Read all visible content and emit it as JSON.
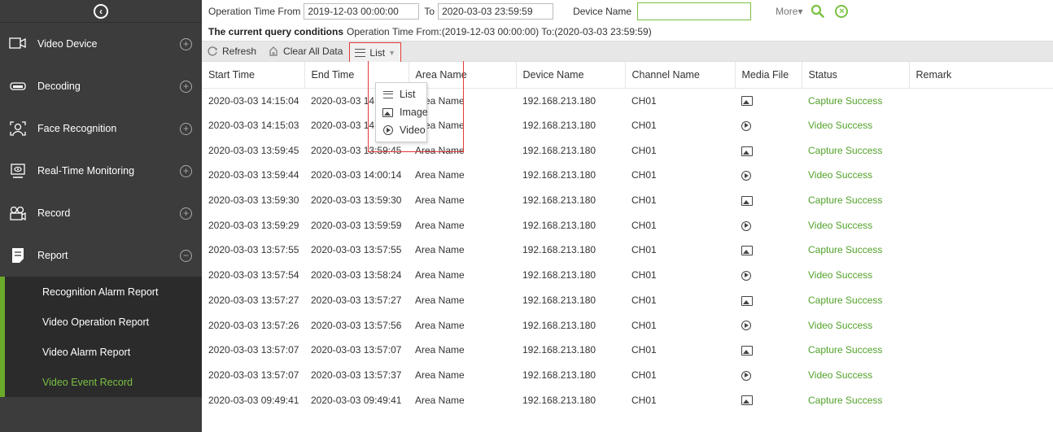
{
  "sidebar": {
    "items": [
      {
        "label": "Video Device",
        "icon": "video-device-icon",
        "toggle": "+"
      },
      {
        "label": "Decoding",
        "icon": "decoding-icon",
        "toggle": "+"
      },
      {
        "label": "Face Recognition",
        "icon": "face-recognition-icon",
        "toggle": "+"
      },
      {
        "label": "Real-Time Monitoring",
        "icon": "monitor-icon",
        "toggle": "+"
      },
      {
        "label": "Record",
        "icon": "record-icon",
        "toggle": "+"
      },
      {
        "label": "Report",
        "icon": "report-icon",
        "toggle": "−"
      }
    ],
    "submenu": [
      "Recognition Alarm Report",
      "Video Operation Report",
      "Video Alarm Report",
      "Video Event Record"
    ],
    "active_submenu": "Video Event Record",
    "accent": "#7ac142"
  },
  "filter": {
    "from_label": "Operation Time From",
    "from_value": "2019-12-03 00:00:00",
    "to_label": "To",
    "to_value": "2020-03-03 23:59:59",
    "device_label": "Device Name",
    "device_value": "",
    "more_label": "More",
    "more_arrow": "▾"
  },
  "conditions": {
    "title": "The current query conditions",
    "text": "Operation Time From:(2019-12-03 00:00:00)  To:(2020-03-03 23:59:59)"
  },
  "toolbar": {
    "refresh": "Refresh",
    "clear": "Clear All Data",
    "view": "List"
  },
  "dropdown": {
    "items": [
      {
        "label": "List",
        "icon": "list-icon"
      },
      {
        "label": "Image",
        "icon": "image-icon"
      },
      {
        "label": "Video",
        "icon": "video-play-icon"
      }
    ]
  },
  "table": {
    "headers": [
      "Start Time",
      "End Time",
      "Area Name",
      "Device Name",
      "Channel Name",
      "Media File",
      "Status",
      "Remark"
    ],
    "rows": [
      {
        "start": "2020-03-03 14:15:04",
        "end": "2020-03-03 14:15:04",
        "area": "Area Name",
        "device": "192.168.213.180",
        "channel": "CH01",
        "media": "image",
        "status": "Capture Success",
        "remark": ""
      },
      {
        "start": "2020-03-03 14:15:03",
        "end": "2020-03-03 14:15:33",
        "area": "Area Name",
        "device": "192.168.213.180",
        "channel": "CH01",
        "media": "video",
        "status": "Video Success",
        "remark": ""
      },
      {
        "start": "2020-03-03 13:59:45",
        "end": "2020-03-03 13:59:45",
        "area": "Area Name",
        "device": "192.168.213.180",
        "channel": "CH01",
        "media": "image",
        "status": "Capture Success",
        "remark": ""
      },
      {
        "start": "2020-03-03 13:59:44",
        "end": "2020-03-03 14:00:14",
        "area": "Area Name",
        "device": "192.168.213.180",
        "channel": "CH01",
        "media": "video",
        "status": "Video Success",
        "remark": ""
      },
      {
        "start": "2020-03-03 13:59:30",
        "end": "2020-03-03 13:59:30",
        "area": "Area Name",
        "device": "192.168.213.180",
        "channel": "CH01",
        "media": "image",
        "status": "Capture Success",
        "remark": ""
      },
      {
        "start": "2020-03-03 13:59:29",
        "end": "2020-03-03 13:59:59",
        "area": "Area Name",
        "device": "192.168.213.180",
        "channel": "CH01",
        "media": "video",
        "status": "Video Success",
        "remark": ""
      },
      {
        "start": "2020-03-03 13:57:55",
        "end": "2020-03-03 13:57:55",
        "area": "Area Name",
        "device": "192.168.213.180",
        "channel": "CH01",
        "media": "image",
        "status": "Capture Success",
        "remark": ""
      },
      {
        "start": "2020-03-03 13:57:54",
        "end": "2020-03-03 13:58:24",
        "area": "Area Name",
        "device": "192.168.213.180",
        "channel": "CH01",
        "media": "video",
        "status": "Video Success",
        "remark": ""
      },
      {
        "start": "2020-03-03 13:57:27",
        "end": "2020-03-03 13:57:27",
        "area": "Area Name",
        "device": "192.168.213.180",
        "channel": "CH01",
        "media": "image",
        "status": "Capture Success",
        "remark": ""
      },
      {
        "start": "2020-03-03 13:57:26",
        "end": "2020-03-03 13:57:56",
        "area": "Area Name",
        "device": "192.168.213.180",
        "channel": "CH01",
        "media": "video",
        "status": "Video Success",
        "remark": ""
      },
      {
        "start": "2020-03-03 13:57:07",
        "end": "2020-03-03 13:57:07",
        "area": "Area Name",
        "device": "192.168.213.180",
        "channel": "CH01",
        "media": "image",
        "status": "Capture Success",
        "remark": ""
      },
      {
        "start": "2020-03-03 13:57:07",
        "end": "2020-03-03 13:57:37",
        "area": "Area Name",
        "device": "192.168.213.180",
        "channel": "CH01",
        "media": "video",
        "status": "Video Success",
        "remark": ""
      },
      {
        "start": "2020-03-03 09:49:41",
        "end": "2020-03-03 09:49:41",
        "area": "Area Name",
        "device": "192.168.213.180",
        "channel": "CH01",
        "media": "image",
        "status": "Capture Success",
        "remark": ""
      }
    ]
  }
}
